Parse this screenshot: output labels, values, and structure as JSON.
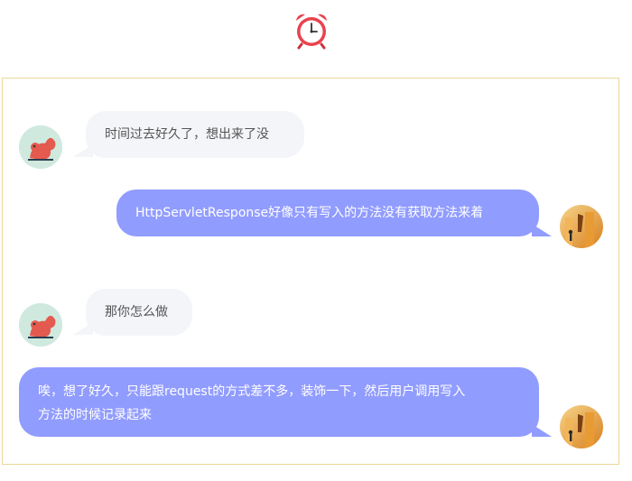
{
  "header": {
    "icon": "alarm-clock-icon"
  },
  "chat": {
    "messages": [
      {
        "side": "left",
        "avatar": "squirrel-avatar",
        "text": "时间过去好久了，想出来了没"
      },
      {
        "side": "right",
        "avatar": "user-avatar",
        "text": "HttpServletResponse好像只有写入的方法没有获取方法来着"
      },
      {
        "side": "left",
        "avatar": "squirrel-avatar",
        "text": "那你怎么做"
      },
      {
        "side": "right",
        "avatar": "user-avatar",
        "line1": "唉，想了好久，只能跟request的方式差不多，装饰一下，然后用户调用写入",
        "line2": "方法的时候记录起来"
      }
    ]
  },
  "colors": {
    "accent": "#919cff",
    "left_bubble": "#f4f5f9",
    "frame_border": "#ecd79a"
  }
}
